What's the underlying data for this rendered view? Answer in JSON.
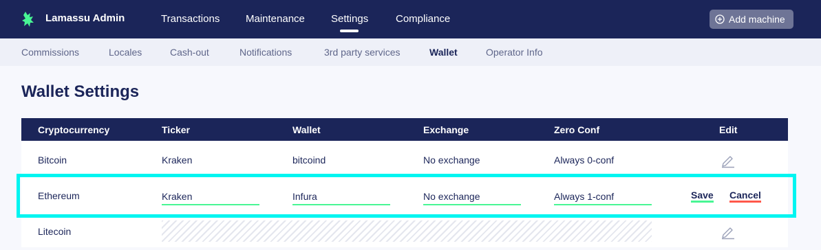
{
  "app": {
    "brand": "Lamassu Admin"
  },
  "nav": {
    "items": [
      {
        "label": "Transactions"
      },
      {
        "label": "Maintenance"
      },
      {
        "label": "Settings"
      },
      {
        "label": "Compliance"
      }
    ],
    "active": "Settings",
    "add_machine_label": "Add machine"
  },
  "subnav": {
    "items": [
      {
        "label": "Commissions"
      },
      {
        "label": "Locales"
      },
      {
        "label": "Cash-out"
      },
      {
        "label": "Notifications"
      },
      {
        "label": "3rd party services"
      },
      {
        "label": "Wallet"
      },
      {
        "label": "Operator Info"
      }
    ],
    "active": "Wallet"
  },
  "page": {
    "title": "Wallet Settings"
  },
  "table": {
    "headers": [
      "Cryptocurrency",
      "Ticker",
      "Wallet",
      "Exchange",
      "Zero Conf",
      "Edit"
    ],
    "rows": [
      {
        "crypto": "Bitcoin",
        "ticker": "Kraken",
        "wallet": "bitcoind",
        "exchange": "No exchange",
        "zero_conf": "Always 0-conf"
      },
      {
        "crypto": "Ethereum",
        "ticker": "Kraken",
        "wallet": "Infura",
        "exchange": "No exchange",
        "zero_conf": "Always 1-conf"
      },
      {
        "crypto": "Litecoin"
      }
    ],
    "save_label": "Save",
    "cancel_label": "Cancel"
  },
  "colors": {
    "navy": "#1b2559",
    "accent_green": "#48f694",
    "accent_red": "#ff584a",
    "highlight": "#00f5f1"
  }
}
